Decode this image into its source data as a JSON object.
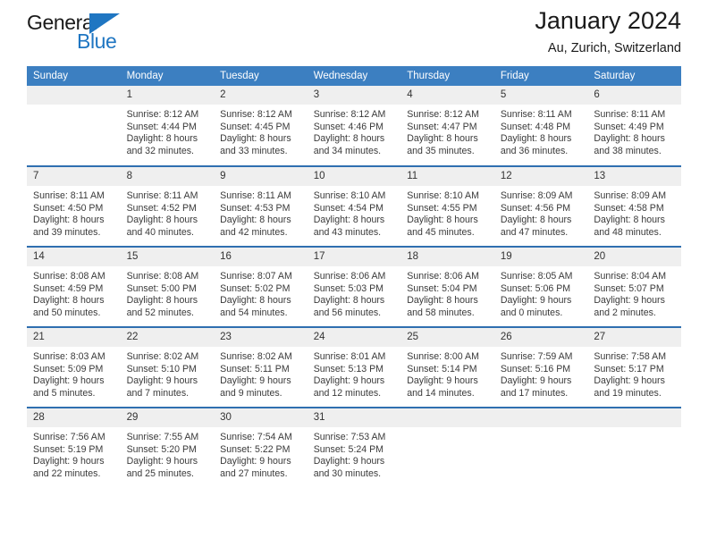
{
  "brand": {
    "name_part1": "General",
    "name_part2": "Blue",
    "flag_icon": "flag-triangle-icon"
  },
  "header": {
    "title": "January 2024",
    "subtitle": "Au, Zurich, Switzerland"
  },
  "colors": {
    "header_blue": "#3c7fc1",
    "row_rule_blue": "#2f6fb0",
    "daynum_band": "#efefef",
    "brand_blue": "#1f76c2",
    "text": "#333333"
  },
  "weekday_headers": [
    "Sunday",
    "Monday",
    "Tuesday",
    "Wednesday",
    "Thursday",
    "Friday",
    "Saturday"
  ],
  "weeks": [
    {
      "days": [
        {
          "num": "",
          "sunrise": "",
          "sunset": "",
          "daylight_line1": "",
          "daylight_line2": ""
        },
        {
          "num": "1",
          "sunrise": "Sunrise: 8:12 AM",
          "sunset": "Sunset: 4:44 PM",
          "daylight_line1": "Daylight: 8 hours",
          "daylight_line2": "and 32 minutes."
        },
        {
          "num": "2",
          "sunrise": "Sunrise: 8:12 AM",
          "sunset": "Sunset: 4:45 PM",
          "daylight_line1": "Daylight: 8 hours",
          "daylight_line2": "and 33 minutes."
        },
        {
          "num": "3",
          "sunrise": "Sunrise: 8:12 AM",
          "sunset": "Sunset: 4:46 PM",
          "daylight_line1": "Daylight: 8 hours",
          "daylight_line2": "and 34 minutes."
        },
        {
          "num": "4",
          "sunrise": "Sunrise: 8:12 AM",
          "sunset": "Sunset: 4:47 PM",
          "daylight_line1": "Daylight: 8 hours",
          "daylight_line2": "and 35 minutes."
        },
        {
          "num": "5",
          "sunrise": "Sunrise: 8:11 AM",
          "sunset": "Sunset: 4:48 PM",
          "daylight_line1": "Daylight: 8 hours",
          "daylight_line2": "and 36 minutes."
        },
        {
          "num": "6",
          "sunrise": "Sunrise: 8:11 AM",
          "sunset": "Sunset: 4:49 PM",
          "daylight_line1": "Daylight: 8 hours",
          "daylight_line2": "and 38 minutes."
        }
      ]
    },
    {
      "days": [
        {
          "num": "7",
          "sunrise": "Sunrise: 8:11 AM",
          "sunset": "Sunset: 4:50 PM",
          "daylight_line1": "Daylight: 8 hours",
          "daylight_line2": "and 39 minutes."
        },
        {
          "num": "8",
          "sunrise": "Sunrise: 8:11 AM",
          "sunset": "Sunset: 4:52 PM",
          "daylight_line1": "Daylight: 8 hours",
          "daylight_line2": "and 40 minutes."
        },
        {
          "num": "9",
          "sunrise": "Sunrise: 8:11 AM",
          "sunset": "Sunset: 4:53 PM",
          "daylight_line1": "Daylight: 8 hours",
          "daylight_line2": "and 42 minutes."
        },
        {
          "num": "10",
          "sunrise": "Sunrise: 8:10 AM",
          "sunset": "Sunset: 4:54 PM",
          "daylight_line1": "Daylight: 8 hours",
          "daylight_line2": "and 43 minutes."
        },
        {
          "num": "11",
          "sunrise": "Sunrise: 8:10 AM",
          "sunset": "Sunset: 4:55 PM",
          "daylight_line1": "Daylight: 8 hours",
          "daylight_line2": "and 45 minutes."
        },
        {
          "num": "12",
          "sunrise": "Sunrise: 8:09 AM",
          "sunset": "Sunset: 4:56 PM",
          "daylight_line1": "Daylight: 8 hours",
          "daylight_line2": "and 47 minutes."
        },
        {
          "num": "13",
          "sunrise": "Sunrise: 8:09 AM",
          "sunset": "Sunset: 4:58 PM",
          "daylight_line1": "Daylight: 8 hours",
          "daylight_line2": "and 48 minutes."
        }
      ]
    },
    {
      "days": [
        {
          "num": "14",
          "sunrise": "Sunrise: 8:08 AM",
          "sunset": "Sunset: 4:59 PM",
          "daylight_line1": "Daylight: 8 hours",
          "daylight_line2": "and 50 minutes."
        },
        {
          "num": "15",
          "sunrise": "Sunrise: 8:08 AM",
          "sunset": "Sunset: 5:00 PM",
          "daylight_line1": "Daylight: 8 hours",
          "daylight_line2": "and 52 minutes."
        },
        {
          "num": "16",
          "sunrise": "Sunrise: 8:07 AM",
          "sunset": "Sunset: 5:02 PM",
          "daylight_line1": "Daylight: 8 hours",
          "daylight_line2": "and 54 minutes."
        },
        {
          "num": "17",
          "sunrise": "Sunrise: 8:06 AM",
          "sunset": "Sunset: 5:03 PM",
          "daylight_line1": "Daylight: 8 hours",
          "daylight_line2": "and 56 minutes."
        },
        {
          "num": "18",
          "sunrise": "Sunrise: 8:06 AM",
          "sunset": "Sunset: 5:04 PM",
          "daylight_line1": "Daylight: 8 hours",
          "daylight_line2": "and 58 minutes."
        },
        {
          "num": "19",
          "sunrise": "Sunrise: 8:05 AM",
          "sunset": "Sunset: 5:06 PM",
          "daylight_line1": "Daylight: 9 hours",
          "daylight_line2": "and 0 minutes."
        },
        {
          "num": "20",
          "sunrise": "Sunrise: 8:04 AM",
          "sunset": "Sunset: 5:07 PM",
          "daylight_line1": "Daylight: 9 hours",
          "daylight_line2": "and 2 minutes."
        }
      ]
    },
    {
      "days": [
        {
          "num": "21",
          "sunrise": "Sunrise: 8:03 AM",
          "sunset": "Sunset: 5:09 PM",
          "daylight_line1": "Daylight: 9 hours",
          "daylight_line2": "and 5 minutes."
        },
        {
          "num": "22",
          "sunrise": "Sunrise: 8:02 AM",
          "sunset": "Sunset: 5:10 PM",
          "daylight_line1": "Daylight: 9 hours",
          "daylight_line2": "and 7 minutes."
        },
        {
          "num": "23",
          "sunrise": "Sunrise: 8:02 AM",
          "sunset": "Sunset: 5:11 PM",
          "daylight_line1": "Daylight: 9 hours",
          "daylight_line2": "and 9 minutes."
        },
        {
          "num": "24",
          "sunrise": "Sunrise: 8:01 AM",
          "sunset": "Sunset: 5:13 PM",
          "daylight_line1": "Daylight: 9 hours",
          "daylight_line2": "and 12 minutes."
        },
        {
          "num": "25",
          "sunrise": "Sunrise: 8:00 AM",
          "sunset": "Sunset: 5:14 PM",
          "daylight_line1": "Daylight: 9 hours",
          "daylight_line2": "and 14 minutes."
        },
        {
          "num": "26",
          "sunrise": "Sunrise: 7:59 AM",
          "sunset": "Sunset: 5:16 PM",
          "daylight_line1": "Daylight: 9 hours",
          "daylight_line2": "and 17 minutes."
        },
        {
          "num": "27",
          "sunrise": "Sunrise: 7:58 AM",
          "sunset": "Sunset: 5:17 PM",
          "daylight_line1": "Daylight: 9 hours",
          "daylight_line2": "and 19 minutes."
        }
      ]
    },
    {
      "days": [
        {
          "num": "28",
          "sunrise": "Sunrise: 7:56 AM",
          "sunset": "Sunset: 5:19 PM",
          "daylight_line1": "Daylight: 9 hours",
          "daylight_line2": "and 22 minutes."
        },
        {
          "num": "29",
          "sunrise": "Sunrise: 7:55 AM",
          "sunset": "Sunset: 5:20 PM",
          "daylight_line1": "Daylight: 9 hours",
          "daylight_line2": "and 25 minutes."
        },
        {
          "num": "30",
          "sunrise": "Sunrise: 7:54 AM",
          "sunset": "Sunset: 5:22 PM",
          "daylight_line1": "Daylight: 9 hours",
          "daylight_line2": "and 27 minutes."
        },
        {
          "num": "31",
          "sunrise": "Sunrise: 7:53 AM",
          "sunset": "Sunset: 5:24 PM",
          "daylight_line1": "Daylight: 9 hours",
          "daylight_line2": "and 30 minutes."
        },
        {
          "num": "",
          "sunrise": "",
          "sunset": "",
          "daylight_line1": "",
          "daylight_line2": ""
        },
        {
          "num": "",
          "sunrise": "",
          "sunset": "",
          "daylight_line1": "",
          "daylight_line2": ""
        },
        {
          "num": "",
          "sunrise": "",
          "sunset": "",
          "daylight_line1": "",
          "daylight_line2": ""
        }
      ]
    }
  ]
}
